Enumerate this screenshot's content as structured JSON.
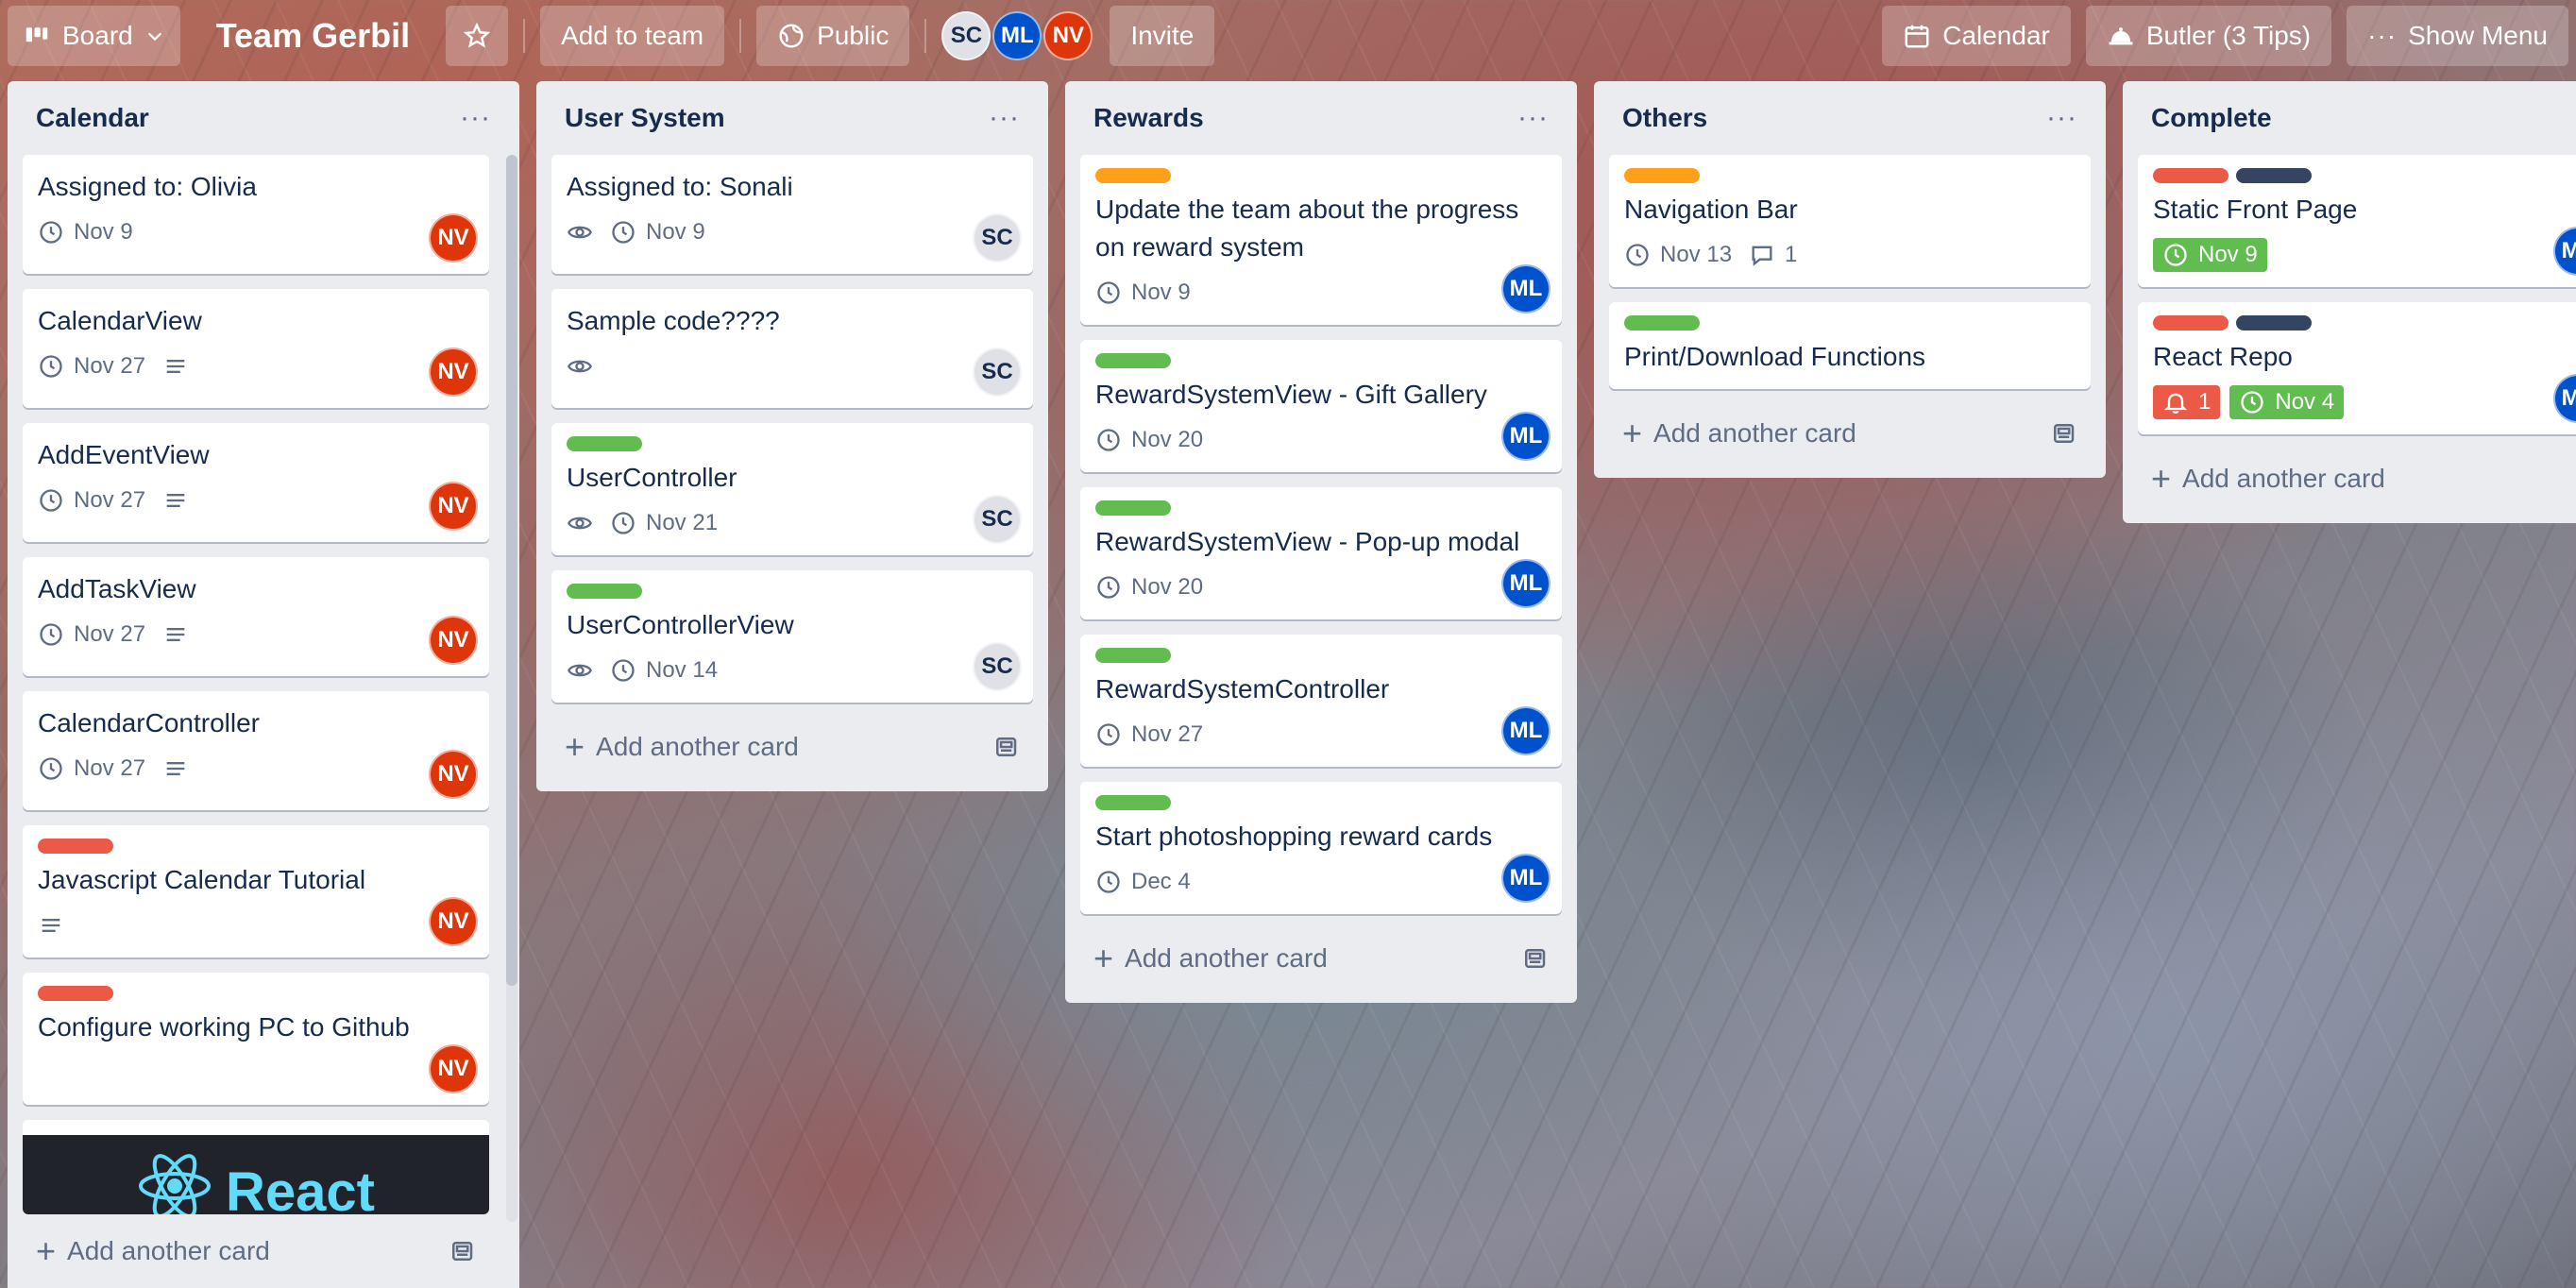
{
  "header": {
    "board_button": "Board",
    "title": "Team Gerbil",
    "add_to_team": "Add to team",
    "visibility": "Public",
    "members": [
      "SC",
      "ML",
      "NV"
    ],
    "invite": "Invite",
    "calendar": "Calendar",
    "butler": "Butler (3 Tips)",
    "show_menu": "Show Menu"
  },
  "add_card_label": "Add another card",
  "lists": [
    {
      "title": "Calendar",
      "cards": [
        {
          "title": "Assigned to: Olivia",
          "due": "Nov 9",
          "member": "NV"
        },
        {
          "title": "CalendarView",
          "due": "Nov 27",
          "member": "NV"
        },
        {
          "title": "AddEventView",
          "due": "Nov 27",
          "member": "NV"
        },
        {
          "title": "AddTaskView",
          "due": "Nov 27",
          "member": "NV"
        },
        {
          "title": "CalendarController",
          "due": "Nov 27",
          "member": "NV"
        },
        {
          "title": "Javascript Calendar Tutorial",
          "member": "NV"
        },
        {
          "title": "Configure working PC to Github",
          "member": "NV"
        }
      ],
      "cover_text": "React"
    },
    {
      "title": "User System",
      "cards": [
        {
          "title": "Assigned to: Sonali",
          "due": "Nov 9",
          "member": "SC"
        },
        {
          "title": "Sample code????",
          "member": "SC"
        },
        {
          "title": "UserController",
          "due": "Nov 21",
          "member": "SC"
        },
        {
          "title": "UserControllerView",
          "due": "Nov 14",
          "member": "SC"
        }
      ]
    },
    {
      "title": "Rewards",
      "cards": [
        {
          "title": "Update the team about the progress on reward system",
          "due": "Nov 9",
          "member": "ML"
        },
        {
          "title": "RewardSystemView - Gift Gallery",
          "due": "Nov 20",
          "member": "ML"
        },
        {
          "title": "RewardSystemView - Pop-up modal",
          "due": "Nov 20",
          "member": "ML"
        },
        {
          "title": "RewardSystemController",
          "due": "Nov 27",
          "member": "ML"
        },
        {
          "title": "Start photoshopping reward cards",
          "due": "Dec 4",
          "member": "ML"
        }
      ]
    },
    {
      "title": "Others",
      "cards": [
        {
          "title": "Navigation Bar",
          "due": "Nov 13",
          "comments": "1"
        },
        {
          "title": "Print/Download Functions"
        }
      ]
    },
    {
      "title": "Complete",
      "cards": [
        {
          "title": "Static Front Page",
          "due": "Nov 9",
          "member": "ML"
        },
        {
          "title": "React Repo",
          "notifications": "1",
          "due": "Nov 4",
          "member": "ML"
        }
      ]
    }
  ],
  "colors": {
    "label_orange": "#ff9f1a",
    "label_green": "#61bd4f",
    "label_red": "#eb5a46",
    "label_navy": "#344563",
    "avatar_ml": "#0052cc",
    "avatar_nv": "#de350b",
    "avatar_sc": "#dfe1e6",
    "list_bg": "#ebecf0"
  }
}
